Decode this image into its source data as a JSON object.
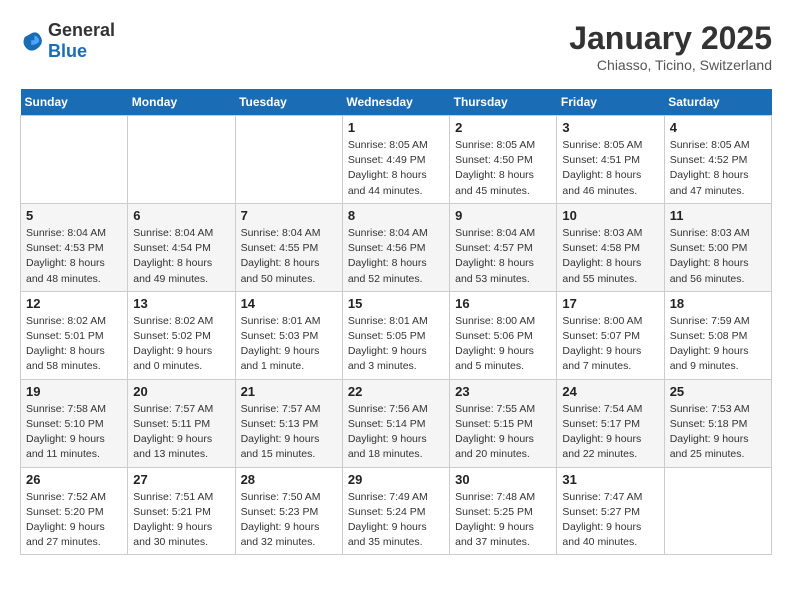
{
  "logo": {
    "general": "General",
    "blue": "Blue"
  },
  "header": {
    "title": "January 2025",
    "subtitle": "Chiasso, Ticino, Switzerland"
  },
  "days_of_week": [
    "Sunday",
    "Monday",
    "Tuesday",
    "Wednesday",
    "Thursday",
    "Friday",
    "Saturday"
  ],
  "weeks": [
    [
      {
        "num": "",
        "info": ""
      },
      {
        "num": "",
        "info": ""
      },
      {
        "num": "",
        "info": ""
      },
      {
        "num": "1",
        "info": "Sunrise: 8:05 AM\nSunset: 4:49 PM\nDaylight: 8 hours\nand 44 minutes."
      },
      {
        "num": "2",
        "info": "Sunrise: 8:05 AM\nSunset: 4:50 PM\nDaylight: 8 hours\nand 45 minutes."
      },
      {
        "num": "3",
        "info": "Sunrise: 8:05 AM\nSunset: 4:51 PM\nDaylight: 8 hours\nand 46 minutes."
      },
      {
        "num": "4",
        "info": "Sunrise: 8:05 AM\nSunset: 4:52 PM\nDaylight: 8 hours\nand 47 minutes."
      }
    ],
    [
      {
        "num": "5",
        "info": "Sunrise: 8:04 AM\nSunset: 4:53 PM\nDaylight: 8 hours\nand 48 minutes."
      },
      {
        "num": "6",
        "info": "Sunrise: 8:04 AM\nSunset: 4:54 PM\nDaylight: 8 hours\nand 49 minutes."
      },
      {
        "num": "7",
        "info": "Sunrise: 8:04 AM\nSunset: 4:55 PM\nDaylight: 8 hours\nand 50 minutes."
      },
      {
        "num": "8",
        "info": "Sunrise: 8:04 AM\nSunset: 4:56 PM\nDaylight: 8 hours\nand 52 minutes."
      },
      {
        "num": "9",
        "info": "Sunrise: 8:04 AM\nSunset: 4:57 PM\nDaylight: 8 hours\nand 53 minutes."
      },
      {
        "num": "10",
        "info": "Sunrise: 8:03 AM\nSunset: 4:58 PM\nDaylight: 8 hours\nand 55 minutes."
      },
      {
        "num": "11",
        "info": "Sunrise: 8:03 AM\nSunset: 5:00 PM\nDaylight: 8 hours\nand 56 minutes."
      }
    ],
    [
      {
        "num": "12",
        "info": "Sunrise: 8:02 AM\nSunset: 5:01 PM\nDaylight: 8 hours\nand 58 minutes."
      },
      {
        "num": "13",
        "info": "Sunrise: 8:02 AM\nSunset: 5:02 PM\nDaylight: 9 hours\nand 0 minutes."
      },
      {
        "num": "14",
        "info": "Sunrise: 8:01 AM\nSunset: 5:03 PM\nDaylight: 9 hours\nand 1 minute."
      },
      {
        "num": "15",
        "info": "Sunrise: 8:01 AM\nSunset: 5:05 PM\nDaylight: 9 hours\nand 3 minutes."
      },
      {
        "num": "16",
        "info": "Sunrise: 8:00 AM\nSunset: 5:06 PM\nDaylight: 9 hours\nand 5 minutes."
      },
      {
        "num": "17",
        "info": "Sunrise: 8:00 AM\nSunset: 5:07 PM\nDaylight: 9 hours\nand 7 minutes."
      },
      {
        "num": "18",
        "info": "Sunrise: 7:59 AM\nSunset: 5:08 PM\nDaylight: 9 hours\nand 9 minutes."
      }
    ],
    [
      {
        "num": "19",
        "info": "Sunrise: 7:58 AM\nSunset: 5:10 PM\nDaylight: 9 hours\nand 11 minutes."
      },
      {
        "num": "20",
        "info": "Sunrise: 7:57 AM\nSunset: 5:11 PM\nDaylight: 9 hours\nand 13 minutes."
      },
      {
        "num": "21",
        "info": "Sunrise: 7:57 AM\nSunset: 5:13 PM\nDaylight: 9 hours\nand 15 minutes."
      },
      {
        "num": "22",
        "info": "Sunrise: 7:56 AM\nSunset: 5:14 PM\nDaylight: 9 hours\nand 18 minutes."
      },
      {
        "num": "23",
        "info": "Sunrise: 7:55 AM\nSunset: 5:15 PM\nDaylight: 9 hours\nand 20 minutes."
      },
      {
        "num": "24",
        "info": "Sunrise: 7:54 AM\nSunset: 5:17 PM\nDaylight: 9 hours\nand 22 minutes."
      },
      {
        "num": "25",
        "info": "Sunrise: 7:53 AM\nSunset: 5:18 PM\nDaylight: 9 hours\nand 25 minutes."
      }
    ],
    [
      {
        "num": "26",
        "info": "Sunrise: 7:52 AM\nSunset: 5:20 PM\nDaylight: 9 hours\nand 27 minutes."
      },
      {
        "num": "27",
        "info": "Sunrise: 7:51 AM\nSunset: 5:21 PM\nDaylight: 9 hours\nand 30 minutes."
      },
      {
        "num": "28",
        "info": "Sunrise: 7:50 AM\nSunset: 5:23 PM\nDaylight: 9 hours\nand 32 minutes."
      },
      {
        "num": "29",
        "info": "Sunrise: 7:49 AM\nSunset: 5:24 PM\nDaylight: 9 hours\nand 35 minutes."
      },
      {
        "num": "30",
        "info": "Sunrise: 7:48 AM\nSunset: 5:25 PM\nDaylight: 9 hours\nand 37 minutes."
      },
      {
        "num": "31",
        "info": "Sunrise: 7:47 AM\nSunset: 5:27 PM\nDaylight: 9 hours\nand 40 minutes."
      },
      {
        "num": "",
        "info": ""
      }
    ]
  ]
}
